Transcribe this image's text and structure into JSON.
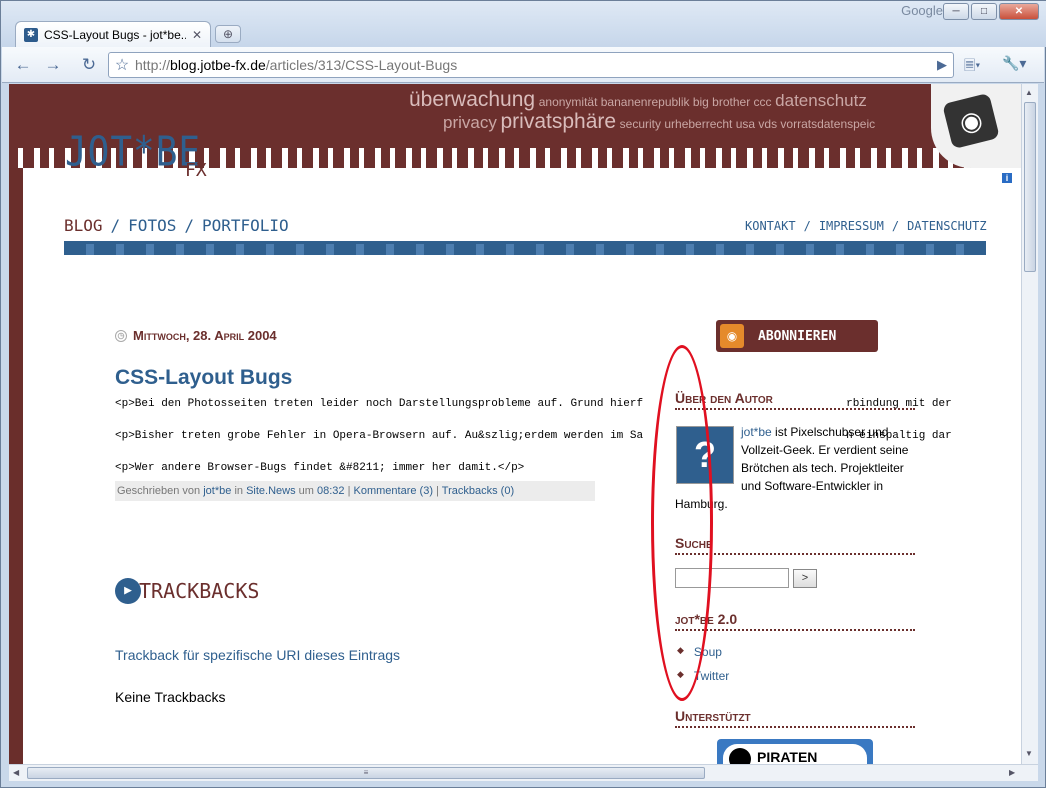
{
  "browser": {
    "brand": "Google",
    "tab_title": "CSS-Layout Bugs - jot*be...",
    "tab_favicon": "jotbe-favicon",
    "url_scheme": "http://",
    "url_domain": "blog.jotbe-fx.de",
    "url_path": "/articles/313/CSS-Layout-Bugs",
    "window_buttons": [
      "minimize",
      "maximize",
      "close"
    ]
  },
  "site": {
    "logo": "JOT*BE",
    "logo_fx": "FX",
    "tag_cloud": {
      "line1_big": "überwachung",
      "line1_small": "anonymität bananenrepublik big brother ccc",
      "line1_mid": "datenschutz",
      "line2_mid": "privacy",
      "line2_big": "privatsphäre",
      "line2_small": "security urheberrecht usa vds vorratsdatenspeic"
    },
    "nav": {
      "blog": "BLOG",
      "sep": "/",
      "fotos": "FOTOS",
      "portfolio": "PORTFOLIO"
    },
    "nav_right": {
      "kontakt": "KONTAKT",
      "sep": "/",
      "impressum": "IMPRESSUM",
      "datenschutz": "DATENSCHUTZ"
    }
  },
  "post": {
    "date": "Mittwoch, 28. April 2004",
    "title": "CSS-Layout Bugs",
    "lines": [
      "<p>Bei den Photosseiten treten leider noch Darstellungsprobleme auf. Grund hierf",
      "<p>Bisher treten grobe Fehler in Opera-Browsern auf. Au&szlig;erdem werden im Sa",
      "<p>Wer andere Browser-Bugs findet &#8211; immer her damit.</p>"
    ],
    "lines_tail": [
      "rbindung mit der",
      "n einspaltig dar"
    ],
    "meta": {
      "prefix": "Geschrieben von",
      "author": "jot*be",
      "in": "in",
      "category": "Site.News",
      "um": "um",
      "time": "08:32",
      "comments": "Kommentare (3)",
      "trackbacks": "Trackbacks (0)",
      "sep": "|"
    }
  },
  "trackbacks": {
    "heading": "TRACKBACKS",
    "link": "Trackback für spezifische URI dieses Eintrags",
    "none": "Keine Trackbacks"
  },
  "sidebar": {
    "abonnieren": "ABONNIEREN",
    "author_heading": "Über den Autor",
    "author_link": "jot*be",
    "author_text": "ist Pixelschubser und Vollzeit-Geek. Er verdient seine Brötchen als tech. Projektleiter und Software-Entwickler in Hamburg.",
    "search_heading": "Suche",
    "search_button": ">",
    "search_value": "",
    "jot_heading": "jot*be 2.0",
    "jot_items": [
      "Soup",
      "Twitter"
    ],
    "support_heading": "Unterstützt",
    "piraten": "PIRATEN"
  },
  "annotation": {
    "color": "#e01020"
  },
  "colors": {
    "brand_brown": "#6b2f2d",
    "brand_blue": "#2f5f8e"
  }
}
